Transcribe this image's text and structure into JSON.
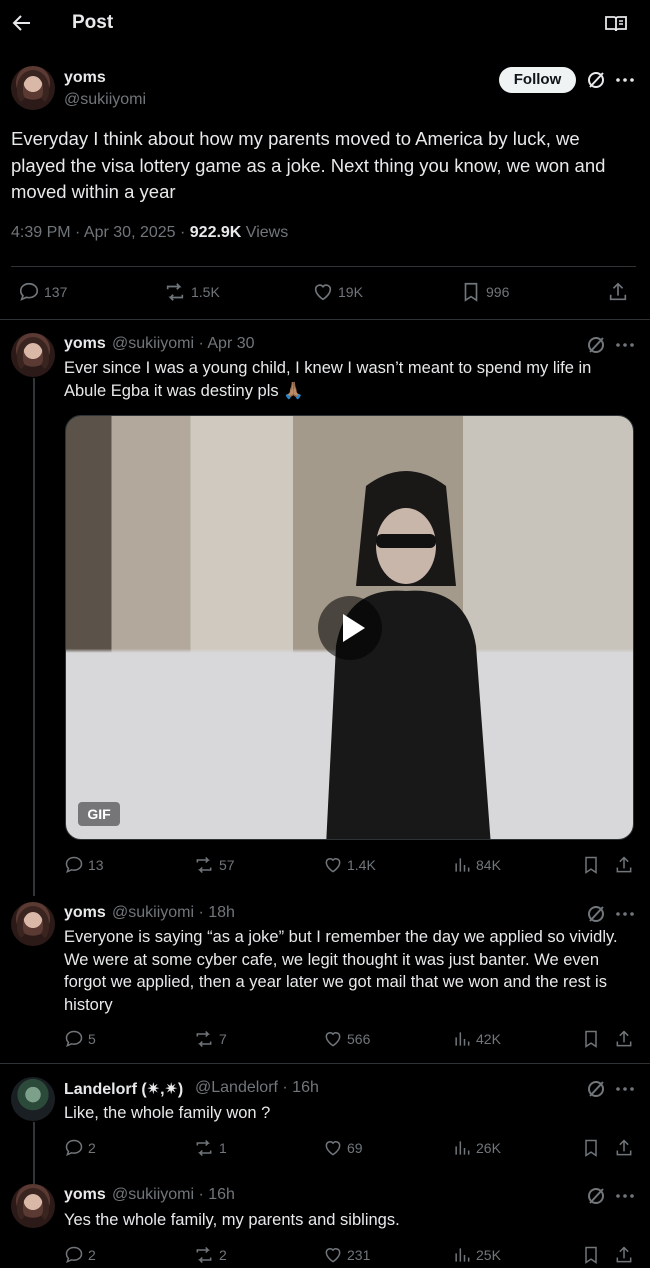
{
  "header": {
    "title": "Post"
  },
  "main_post": {
    "name": "yoms",
    "handle": "@sukiiyomi",
    "follow_label": "Follow",
    "text": "Everyday I think about how my parents moved to America by luck, we played the visa lottery game as a joke. Next thing you know, we won and moved within a year",
    "timestamp": "4:39 PM · Apr 30, 2025 · ",
    "views_count": "922.9K",
    "views_label": " Views",
    "replies": "137",
    "reposts": "1.5K",
    "likes": "19K",
    "bookmarks": "996"
  },
  "replies": [
    {
      "name": "yoms",
      "handle": "@sukiiyomi · Apr 30",
      "text": "Ever since I was a young child, I knew I wasn’t meant to spend my life in Abule Egba it was destiny pls 🙏🏽",
      "media_badge": "GIF",
      "replies": "13",
      "reposts": "57",
      "likes": "1.4K",
      "views": "84K"
    },
    {
      "name": "yoms",
      "handle": "@sukiiyomi · 18h",
      "text": "Everyone is saying “as a joke” but I remember the day we applied so vividly. We were at some cyber cafe, we legit thought it was just banter. We even forgot we applied, then a year later we got mail that we won and the rest is history",
      "replies": "5",
      "reposts": "7",
      "likes": "566",
      "views": "42K"
    },
    {
      "name": "Landelorf (✷,✷)",
      "handle": "@Landelorf · 16h",
      "text": "Like, the whole family won ?",
      "replies": "2",
      "reposts": "1",
      "likes": "69",
      "views": "26K"
    },
    {
      "name": "yoms",
      "handle": "@sukiiyomi · 16h",
      "text": "Yes the whole family, my parents and siblings.",
      "replies": "2",
      "reposts": "2",
      "likes": "231",
      "views": "25K"
    }
  ],
  "colors": {
    "background": "#000000",
    "text": "#e7e9ea",
    "secondary": "#71767b",
    "divider": "#2f3336"
  },
  "icons": [
    "back-arrow-icon",
    "reader-mode-icon",
    "grok-icon",
    "more-icon",
    "reply-icon",
    "repost-icon",
    "like-icon",
    "bookmark-icon",
    "share-icon",
    "views-icon",
    "play-icon"
  ]
}
